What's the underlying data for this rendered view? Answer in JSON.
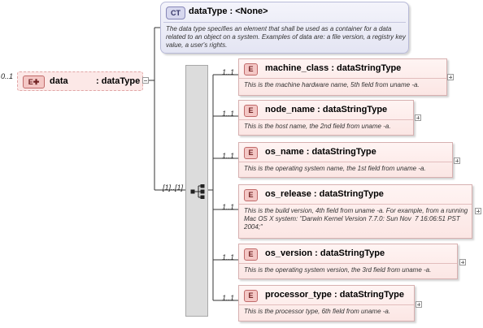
{
  "complex_type": {
    "badge": "CT",
    "title": "dataType : <None>",
    "description": "The data type specifies an element that shall be used as a container for a data related to an object on a system. Examples of data are: a file version, a registry key value, a user's rights."
  },
  "root_element": {
    "occurrence": "0..1",
    "badge": "E",
    "name": "data",
    "type": ": dataType"
  },
  "sequence": {
    "occurrence": "[1]..[1]"
  },
  "children": [
    {
      "occurrence": "1..1",
      "badge": "E",
      "title": "machine_class : dataStringType",
      "description": "This is the machine hardware name, 5th field from uname -a."
    },
    {
      "occurrence": "1..1",
      "badge": "E",
      "title": "node_name : dataStringType",
      "description": "This is the host name, the 2nd field from uname -a."
    },
    {
      "occurrence": "1..1",
      "badge": "E",
      "title": "os_name : dataStringType",
      "description": "This is the operating system name, the 1st field from uname -a."
    },
    {
      "occurrence": "1..1",
      "badge": "E",
      "title": "os_release : dataStringType",
      "description": "This is the build version, 4th field from uname -a. For example, from a running Mac OS X system: \"Darwin Kernel Version 7.7.0: Sun Nov  7 16:06:51 PST 2004;\""
    },
    {
      "occurrence": "1..1",
      "badge": "E",
      "title": "os_version : dataStringType",
      "description": "This is the operating system version, the 3rd field from uname -a."
    },
    {
      "occurrence": "1..1",
      "badge": "E",
      "title": "processor_type : dataStringType",
      "description": "This is the processor type, 6th field from uname -a."
    }
  ]
}
